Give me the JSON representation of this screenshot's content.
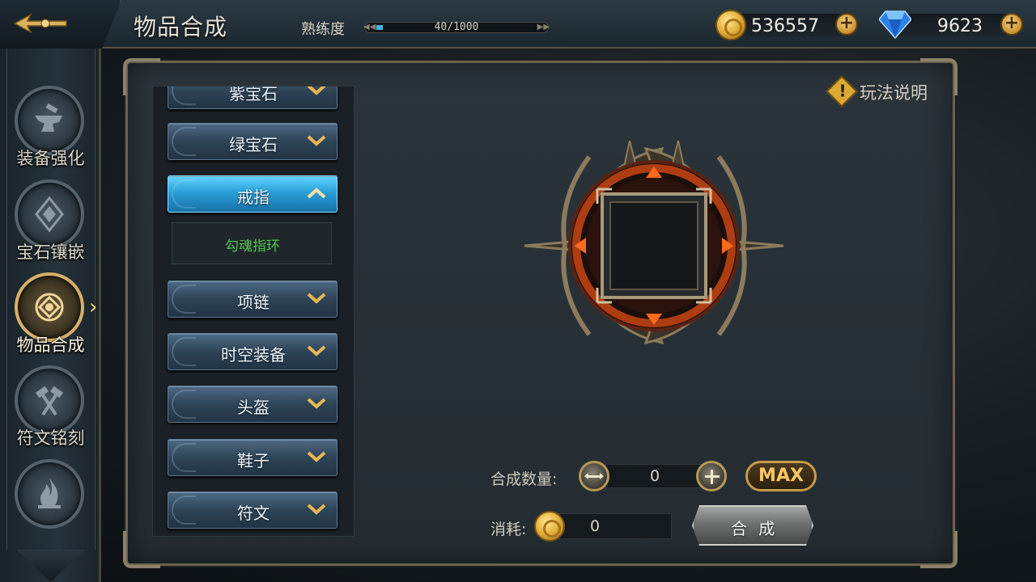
{
  "header": {
    "title": "物品合成",
    "proficiency_label": "熟练度",
    "proficiency_text": "40/1000",
    "proficiency_fraction": 0.04,
    "gold": "536557",
    "diamonds": "9623"
  },
  "sidebar": {
    "items": [
      {
        "label": "装备强化",
        "icon": "anvil-icon"
      },
      {
        "label": "宝石镶嵌",
        "icon": "gem-socket-icon"
      },
      {
        "label": "物品合成",
        "icon": "synthesis-icon",
        "active": true
      },
      {
        "label": "符文铭刻",
        "icon": "rune-hammers-icon"
      },
      {
        "label": "",
        "icon": "flame-icon"
      }
    ]
  },
  "categories": {
    "partial_top": "紫宝石",
    "items": [
      {
        "label": "绿宝石",
        "expanded": false
      },
      {
        "label": "戒指",
        "expanded": true
      },
      {
        "label": "项链",
        "expanded": false
      },
      {
        "label": "时空装备",
        "expanded": false
      },
      {
        "label": "头盔",
        "expanded": false
      },
      {
        "label": "鞋子",
        "expanded": false
      },
      {
        "label": "符文",
        "expanded": false
      }
    ],
    "sub_item": "勾魂指环"
  },
  "help": {
    "label": "玩法说明"
  },
  "synthesis": {
    "quantity_label": "合成数量:",
    "quantity_value": "0",
    "max_label": "MAX",
    "cost_label": "消耗:",
    "cost_value": "0",
    "button_label": "合 成"
  },
  "colors": {
    "accent_gold": "#d6b06a",
    "selected_blue": "#2a9fd6",
    "sub_item_green": "#4fc64a",
    "emblem_orange": "#e0561b"
  }
}
